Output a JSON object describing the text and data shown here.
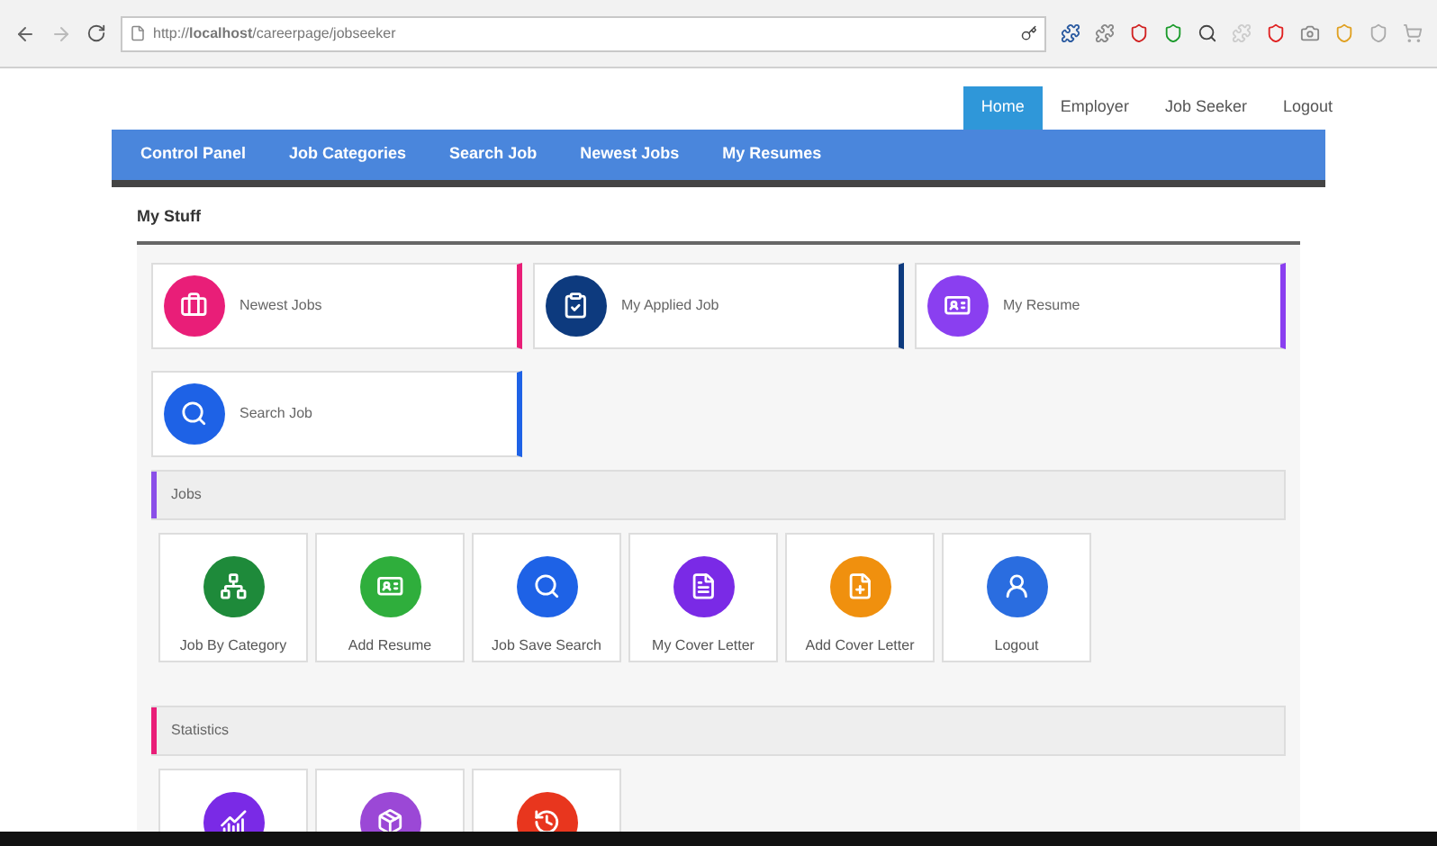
{
  "browser": {
    "url_host": "http://**localhost**/careerpage/jobseeker"
  },
  "top_nav": [
    {
      "label": "Home",
      "selected": true
    },
    {
      "label": "Employer",
      "selected": false
    },
    {
      "label": "Job Seeker",
      "selected": false
    },
    {
      "label": "Logout",
      "selected": false
    }
  ],
  "menu": [
    "Control Panel",
    "Job Categories",
    "Search Job",
    "Newest Jobs",
    "My Resumes"
  ],
  "my_stuff": {
    "title": "My Stuff",
    "cards": [
      {
        "label": "Newest Jobs",
        "color": "#e91e78"
      },
      {
        "label": "My Applied Job",
        "color": "#0d3a7e"
      },
      {
        "label": "My Resume",
        "color": "#8a3ff0"
      },
      {
        "label": "Search Job",
        "color": "#1e62e6"
      }
    ]
  },
  "sections": [
    {
      "title": "Jobs",
      "color": "#8a4fe8",
      "tiles": [
        {
          "label": "Job By Category",
          "color": "#1e8a3a"
        },
        {
          "label": "Add Resume",
          "color": "#2fae3c"
        },
        {
          "label": "Job Save Search",
          "color": "#1e62e6"
        },
        {
          "label": "My Cover Letter",
          "color": "#7a2ae6"
        },
        {
          "label": "Add Cover Letter",
          "color": "#f0900e"
        },
        {
          "label": "Logout",
          "color": "#2a6de0"
        }
      ]
    },
    {
      "title": "Statistics",
      "color": "#e91e78",
      "tiles": [
        {
          "color": "#7a2ae6"
        },
        {
          "color": "#9b48d6"
        },
        {
          "color": "#e8361e"
        }
      ]
    }
  ]
}
